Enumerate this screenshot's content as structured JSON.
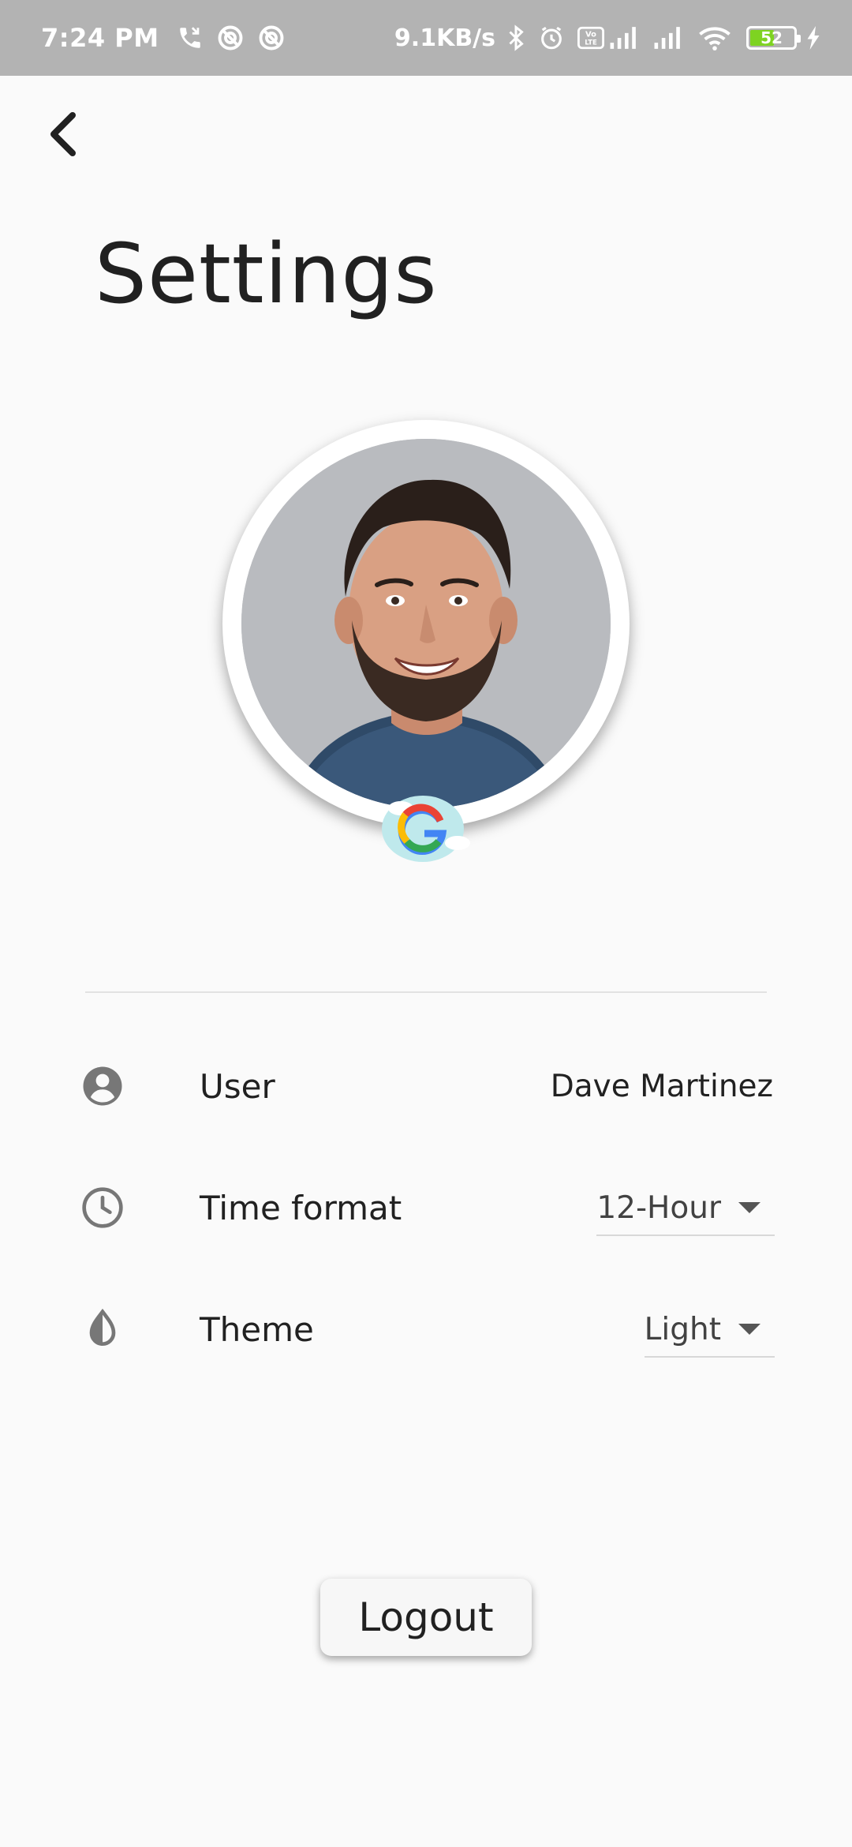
{
  "status_bar": {
    "time": "7:24 PM",
    "net_speed": "9.1KB/s",
    "battery_level": "52",
    "icons": [
      "missed-call-icon",
      "sync-icon",
      "sync-icon",
      "bluetooth-icon",
      "alarm-icon",
      "volte-icon",
      "signal-icon",
      "signal-icon",
      "wifi-icon",
      "battery-icon",
      "charging-icon"
    ]
  },
  "header": {
    "back_icon": "chevron-left-icon",
    "title": "Settings"
  },
  "profile": {
    "badge_icon": "google-icon"
  },
  "settings": {
    "user": {
      "icon": "account-circle-icon",
      "label": "User",
      "value": "Dave Martinez"
    },
    "time_format": {
      "icon": "clock-icon",
      "label": "Time format",
      "value": "12-Hour"
    },
    "theme": {
      "icon": "contrast-drop-icon",
      "label": "Theme",
      "value": "Light"
    }
  },
  "actions": {
    "logout_label": "Logout"
  },
  "colors": {
    "status_bar_bg": "#b3b3b3",
    "background": "#fafafa",
    "text": "#212121",
    "icon_gray": "#777777",
    "battery_green": "#7ed321"
  }
}
